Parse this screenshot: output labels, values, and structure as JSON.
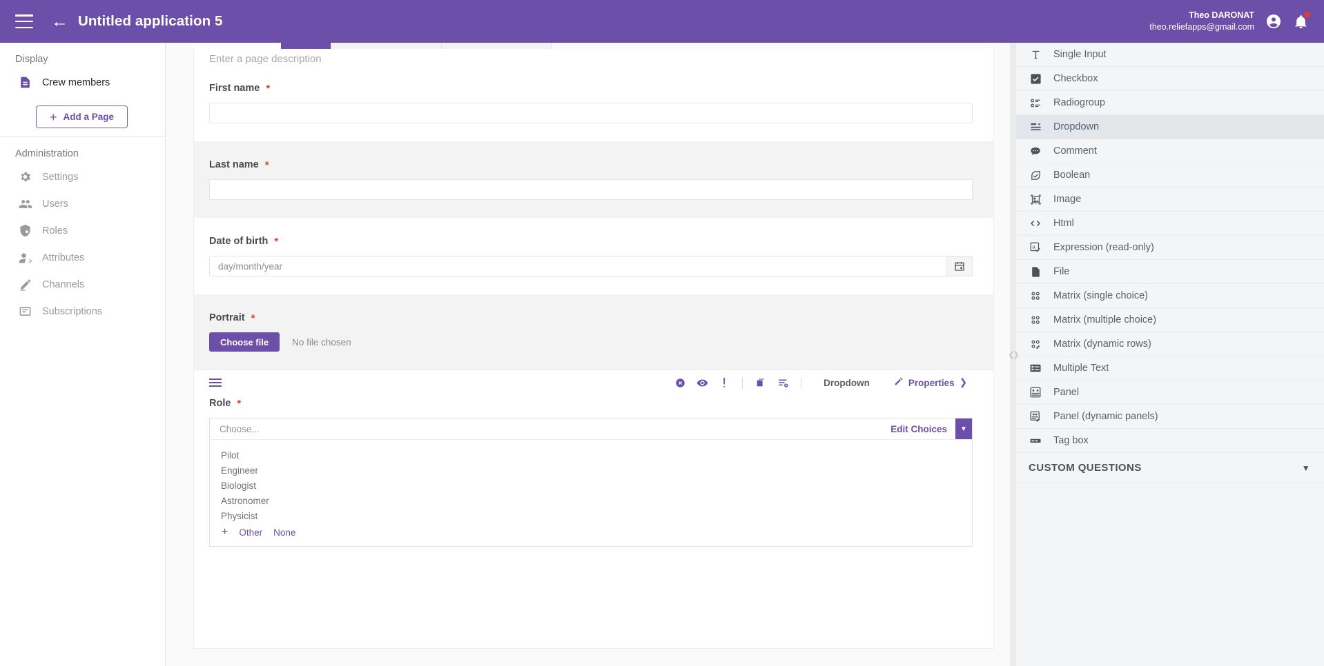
{
  "topbar": {
    "menu_icon": "hamburger-icon",
    "back_icon": "arrow-left-icon",
    "title": "Untitled application 5",
    "user_name": "Theo DARONAT",
    "user_email": "theo.reliefapps@gmail.com",
    "account_icon": "account-circle-icon",
    "notification_icon": "bell-icon"
  },
  "sidebar": {
    "display_title": "Display",
    "pages": [
      {
        "label": "Crew members",
        "icon": "document-icon"
      }
    ],
    "add_page_label": "Add a Page",
    "add_page_icon": "plus-icon",
    "admin_title": "Administration",
    "admin_items": [
      {
        "label": "Settings",
        "icon": "gear-icon"
      },
      {
        "label": "Users",
        "icon": "users-icon"
      },
      {
        "label": "Roles",
        "icon": "shield-icon"
      },
      {
        "label": "Attributes",
        "icon": "user-settings-icon"
      },
      {
        "label": "Channels",
        "icon": "channel-icon"
      },
      {
        "label": "Subscriptions",
        "icon": "subscriptions-icon"
      }
    ]
  },
  "canvas": {
    "page_description_placeholder": "Enter a page description",
    "questions": [
      {
        "label": "First name",
        "required": "*",
        "type": "text",
        "value": ""
      },
      {
        "label": "Last name",
        "required": "*",
        "type": "text",
        "value": ""
      },
      {
        "label": "Date of birth",
        "required": "*",
        "type": "date",
        "placeholder": "day/month/year",
        "calendar_icon": "calendar-icon"
      },
      {
        "label": "Portrait",
        "required": "*",
        "type": "file",
        "button_label": "Choose file",
        "status_text": "No file chosen"
      }
    ],
    "selected_question": {
      "label": "Role",
      "required": "*",
      "type_label": "Dropdown",
      "properties_label": "Properties",
      "properties_icon": "pencil-icon",
      "properties_chevron": "chevron-right-icon",
      "drag_handle_icon": "drag-handle-icon",
      "toolbar_icons": [
        {
          "name": "delete-circle-icon",
          "glyph": "⊗"
        },
        {
          "name": "eye-icon",
          "glyph": "◉"
        },
        {
          "name": "required-icon",
          "glyph": "!"
        },
        {
          "name": "duplicate-icon",
          "glyph": "❐"
        },
        {
          "name": "add-to-list-icon",
          "glyph": "≡"
        }
      ],
      "placeholder": "Choose...",
      "edit_choices_label": "Edit Choices",
      "caret_icon": "chevron-down-icon",
      "options": [
        "Pilot",
        "Engineer",
        "Biologist",
        "Astronomer",
        "Physicist"
      ],
      "add_icon": "plus-icon",
      "other_label": "Other",
      "none_label": "None"
    }
  },
  "right_panel": {
    "items": [
      {
        "label": "Single Input",
        "icon": "text-input-icon",
        "selected": false
      },
      {
        "label": "Checkbox",
        "icon": "checkbox-icon",
        "selected": false
      },
      {
        "label": "Radiogroup",
        "icon": "radiogroup-icon",
        "selected": false
      },
      {
        "label": "Dropdown",
        "icon": "dropdown-icon",
        "selected": true
      },
      {
        "label": "Comment",
        "icon": "comment-icon",
        "selected": false
      },
      {
        "label": "Boolean",
        "icon": "boolean-icon",
        "selected": false
      },
      {
        "label": "Image",
        "icon": "image-icon",
        "selected": false
      },
      {
        "label": "Html",
        "icon": "code-icon",
        "selected": false
      },
      {
        "label": "Expression (read-only)",
        "icon": "expression-icon",
        "selected": false
      },
      {
        "label": "File",
        "icon": "file-icon",
        "selected": false
      },
      {
        "label": "Matrix (single choice)",
        "icon": "matrix-single-icon",
        "selected": false
      },
      {
        "label": "Matrix (multiple choice)",
        "icon": "matrix-multiple-icon",
        "selected": false
      },
      {
        "label": "Matrix (dynamic rows)",
        "icon": "matrix-dynamic-icon",
        "selected": false
      },
      {
        "label": "Multiple Text",
        "icon": "multiple-text-icon",
        "selected": false
      },
      {
        "label": "Panel",
        "icon": "panel-icon",
        "selected": false
      },
      {
        "label": "Panel (dynamic panels)",
        "icon": "panel-dynamic-icon",
        "selected": false
      },
      {
        "label": "Tag box",
        "icon": "tagbox-icon",
        "selected": false
      }
    ],
    "custom_section_label": "CUSTOM QUESTIONS",
    "custom_section_chevron": "chevron-down-icon"
  },
  "colors": {
    "brand_purple": "#6b4fa8",
    "required_red": "#f03a2e",
    "panel_bg": "#f4f5f6",
    "selected_row": "#e3e7eb"
  }
}
